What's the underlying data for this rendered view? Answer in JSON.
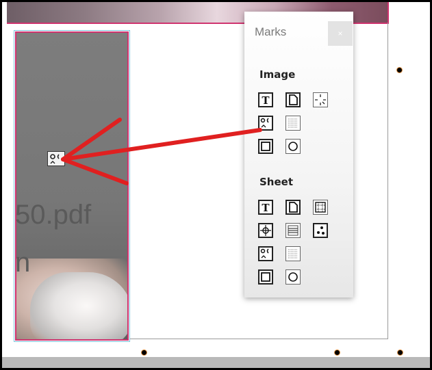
{
  "panel": {
    "title": "Marks",
    "close_glyph": "×",
    "sections": [
      {
        "label": "Image",
        "buttons": [
          "text-mark-icon",
          "page-mark-icon",
          "crop-corners-icon",
          "registration-face-icon",
          "lines-mark-icon",
          "rectangle-mark-icon",
          "circle-mark-icon"
        ]
      },
      {
        "label": "Sheet",
        "buttons": [
          "text-mark-icon",
          "page-mark-icon",
          "grid-frame-icon",
          "crosshair-mark-icon",
          "stripe-mark-icon",
          "dots-mark-icon",
          "registration-face-icon",
          "lines-mark-icon",
          "rectangle-mark-icon",
          "circle-mark-icon"
        ]
      }
    ]
  },
  "canvas": {
    "filename_fragment": "50.pdf",
    "partial_letter": "n"
  },
  "colors": {
    "arrow": "#e02020",
    "selection_border": "#d0336f",
    "frame_guide": "#7fc6dd"
  }
}
